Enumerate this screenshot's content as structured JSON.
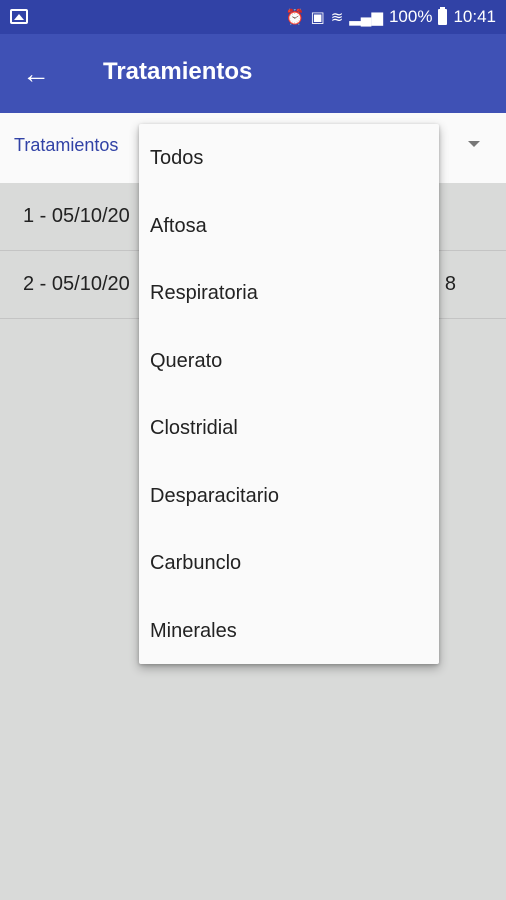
{
  "status_bar": {
    "icons": [
      "gallery-icon",
      "alarm-icon",
      "nfc-icon",
      "wifi-icon",
      "signal-icon"
    ],
    "battery": "100%",
    "time": "10:41"
  },
  "app_bar": {
    "back_icon": "arrow-left-icon",
    "title": "Tratamientos"
  },
  "filter": {
    "label": "Tratamientos"
  },
  "list": {
    "rows": [
      {
        "text": "1 - 05/10/20",
        "right": ""
      },
      {
        "text": "2 - 05/10/20",
        "right": "8"
      }
    ]
  },
  "dropdown": {
    "items": [
      "Todos",
      "Aftosa",
      "Respiratoria",
      "Querato",
      "Clostridial",
      "Desparacitario",
      "Carbunclo",
      "Minerales"
    ]
  },
  "colors": {
    "status_bar": "#3142a6",
    "app_bar": "#3f51b5",
    "accent_text": "#3142a6",
    "background": "#d9dad9"
  }
}
